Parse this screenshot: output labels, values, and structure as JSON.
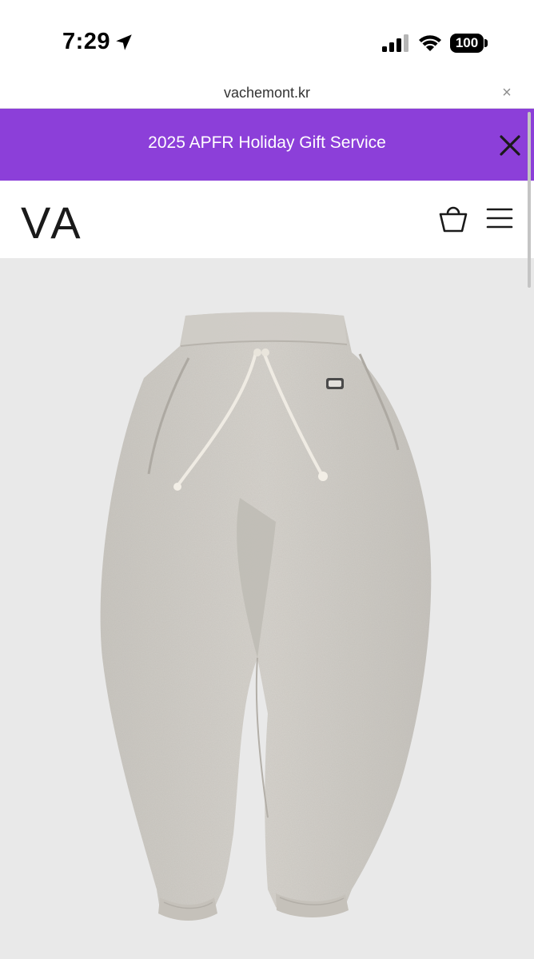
{
  "status_bar": {
    "time": "7:29",
    "battery": "100",
    "icons": [
      "location-arrow-icon",
      "signal-icon",
      "wifi-icon",
      "battery-icon"
    ]
  },
  "browser": {
    "url": "vachemont.kr",
    "close_glyph": "×"
  },
  "promo_banner": {
    "text": "2025 APFR Holiday Gift Service",
    "background": "#8c3fd9"
  },
  "header": {
    "logo": "VA",
    "icons": [
      "cart-icon",
      "menu-icon"
    ]
  },
  "hero": {
    "subject": "product-image-sweatpants",
    "background": "#e9e9e9"
  }
}
